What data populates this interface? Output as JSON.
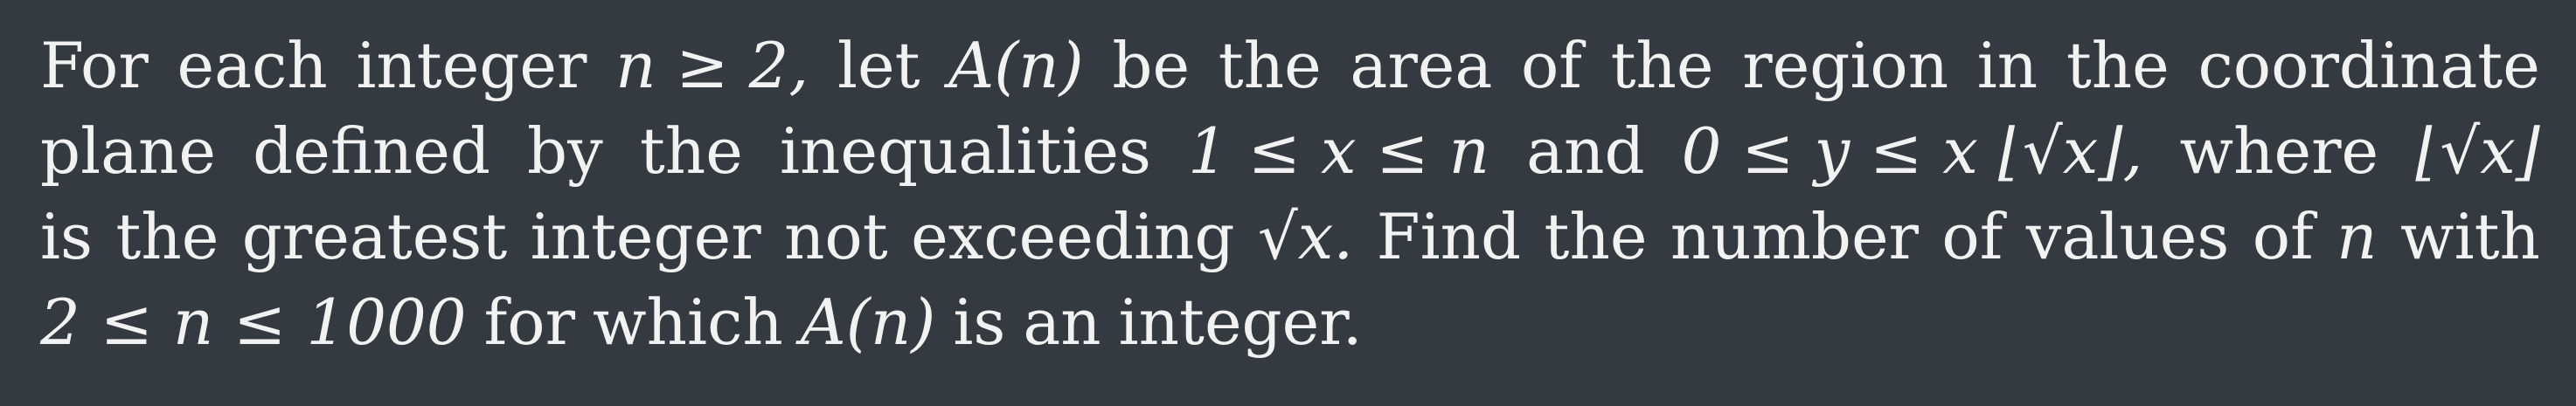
{
  "problem": {
    "lines": [
      [
        "For",
        "each",
        "integer",
        "n ≥ 2,",
        "let",
        "A(n)",
        "be",
        "the",
        "area",
        "of",
        "the",
        "region",
        "in",
        "the",
        "coordinate"
      ],
      [
        "plane",
        "defined",
        "by",
        "the",
        "inequalities",
        "1 ≤ x ≤ n",
        "and",
        "0 ≤ y ≤ x ⌊√x⌋,",
        "where",
        "⌊√x⌋"
      ],
      [
        "is",
        "the",
        "greatest",
        "integer",
        "not",
        "exceeding",
        "√x.",
        "Find",
        "the",
        "number",
        "of",
        "values",
        "of",
        "n",
        "with"
      ],
      [
        "2 ≤ n ≤ 1000",
        "for",
        "which",
        "A(n)",
        "is",
        "an",
        "integer."
      ]
    ]
  }
}
